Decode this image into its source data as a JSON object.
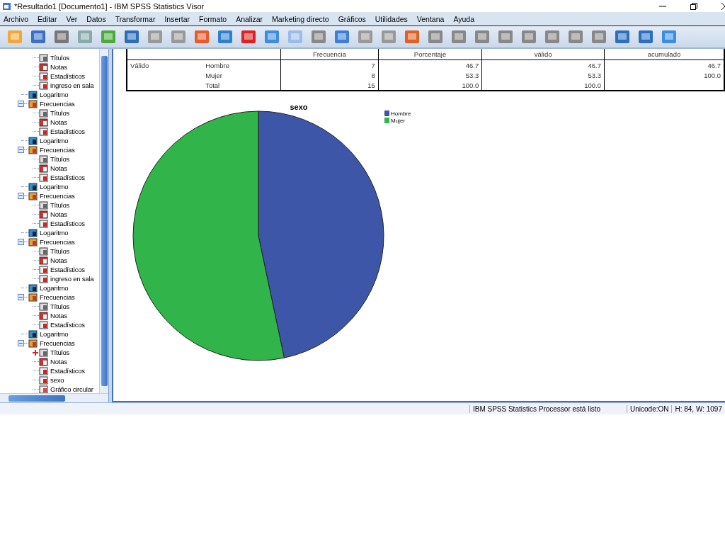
{
  "window": {
    "title": "*Resultado1 [Documento1] - IBM SPSS Statistics Visor"
  },
  "menu": [
    "Archivo",
    "Editar",
    "Ver",
    "Datos",
    "Transformar",
    "Insertar",
    "Formato",
    "Analizar",
    "Marketing directo",
    "Gráficos",
    "Utilidades",
    "Ventana",
    "Ayuda"
  ],
  "tree": {
    "items": [
      {
        "kind": "group",
        "children": [
          {
            "label": "Títulos",
            "kind": "titles",
            "current": false
          },
          {
            "label": "Notas",
            "kind": "notes",
            "current": false
          },
          {
            "label": "Estadísticos",
            "kind": "stats",
            "current": false
          },
          {
            "label": "ingreso en sala",
            "kind": "stats",
            "current": false
          }
        ]
      },
      {
        "kind": "log",
        "label": "Logaritmo"
      },
      {
        "kind": "group",
        "label": "Frecuencias",
        "expanded": true,
        "children": [
          {
            "label": "Títulos",
            "kind": "titles",
            "current": false
          },
          {
            "label": "Notas",
            "kind": "notes",
            "current": false
          },
          {
            "label": "Estadísticos",
            "kind": "stats",
            "current": false
          }
        ]
      },
      {
        "kind": "log",
        "label": "Logaritmo"
      },
      {
        "kind": "group",
        "label": "Frecuencias",
        "expanded": true,
        "children": [
          {
            "label": "Títulos",
            "kind": "titles",
            "current": false
          },
          {
            "label": "Notas",
            "kind": "notes",
            "current": false
          },
          {
            "label": "Estadísticos",
            "kind": "stats",
            "current": false
          }
        ]
      },
      {
        "kind": "log",
        "label": "Logaritmo"
      },
      {
        "kind": "group",
        "label": "Frecuencias",
        "expanded": true,
        "children": [
          {
            "label": "Títulos",
            "kind": "titles",
            "current": false
          },
          {
            "label": "Notas",
            "kind": "notes",
            "current": false
          },
          {
            "label": "Estadísticos",
            "kind": "stats",
            "current": false
          }
        ]
      },
      {
        "kind": "log",
        "label": "Logaritmo"
      },
      {
        "kind": "group",
        "label": "Frecuencias",
        "expanded": true,
        "children": [
          {
            "label": "Títulos",
            "kind": "titles",
            "current": false
          },
          {
            "label": "Notas",
            "kind": "notes",
            "current": false
          },
          {
            "label": "Estadísticos",
            "kind": "stats",
            "current": false
          },
          {
            "label": "ingreso en sala",
            "kind": "stats",
            "current": false
          }
        ]
      },
      {
        "kind": "log",
        "label": "Logaritmo"
      },
      {
        "kind": "group",
        "label": "Frecuencias",
        "expanded": true,
        "children": [
          {
            "label": "Títulos",
            "kind": "titles",
            "current": false
          },
          {
            "label": "Notas",
            "kind": "notes",
            "current": false
          },
          {
            "label": "Estadísticos",
            "kind": "stats",
            "current": false
          }
        ]
      },
      {
        "kind": "log",
        "label": "Logaritmo"
      },
      {
        "kind": "group",
        "label": "Frecuencias",
        "expanded": true,
        "children": [
          {
            "label": "Títulos",
            "kind": "titles",
            "current": true
          },
          {
            "label": "Notas",
            "kind": "notes",
            "current": false
          },
          {
            "label": "Estadísticos",
            "kind": "stats",
            "current": false
          },
          {
            "label": "sexo",
            "kind": "stats",
            "current": false
          },
          {
            "label": "Gráfico circular",
            "kind": "chart",
            "current": false
          }
        ]
      }
    ]
  },
  "table": {
    "columns": [
      "",
      "",
      "Frecuencia",
      "Porcentaje",
      "válido",
      "acumulado"
    ],
    "rows": [
      [
        "Válido",
        "Hombre",
        "7",
        "46.7",
        "46.7",
        "46.7"
      ],
      [
        "",
        "Mujer",
        "8",
        "53.3",
        "53.3",
        "100.0"
      ],
      [
        "",
        "Total",
        "15",
        "100.0",
        "100.0",
        ""
      ]
    ]
  },
  "chart": {
    "chart_data": {
      "type": "pie",
      "title": "sexo",
      "categories": [
        "Hombre",
        "Mujer"
      ],
      "values": [
        46.7,
        53.3
      ],
      "colors": [
        "#3d56a8",
        "#31b54a"
      ],
      "legend": "top-right"
    }
  },
  "status_bar": [
    "IBM SPSS Statistics Processor está listo",
    "Unicode:ON",
    "H: 84, W: 1097"
  ]
}
